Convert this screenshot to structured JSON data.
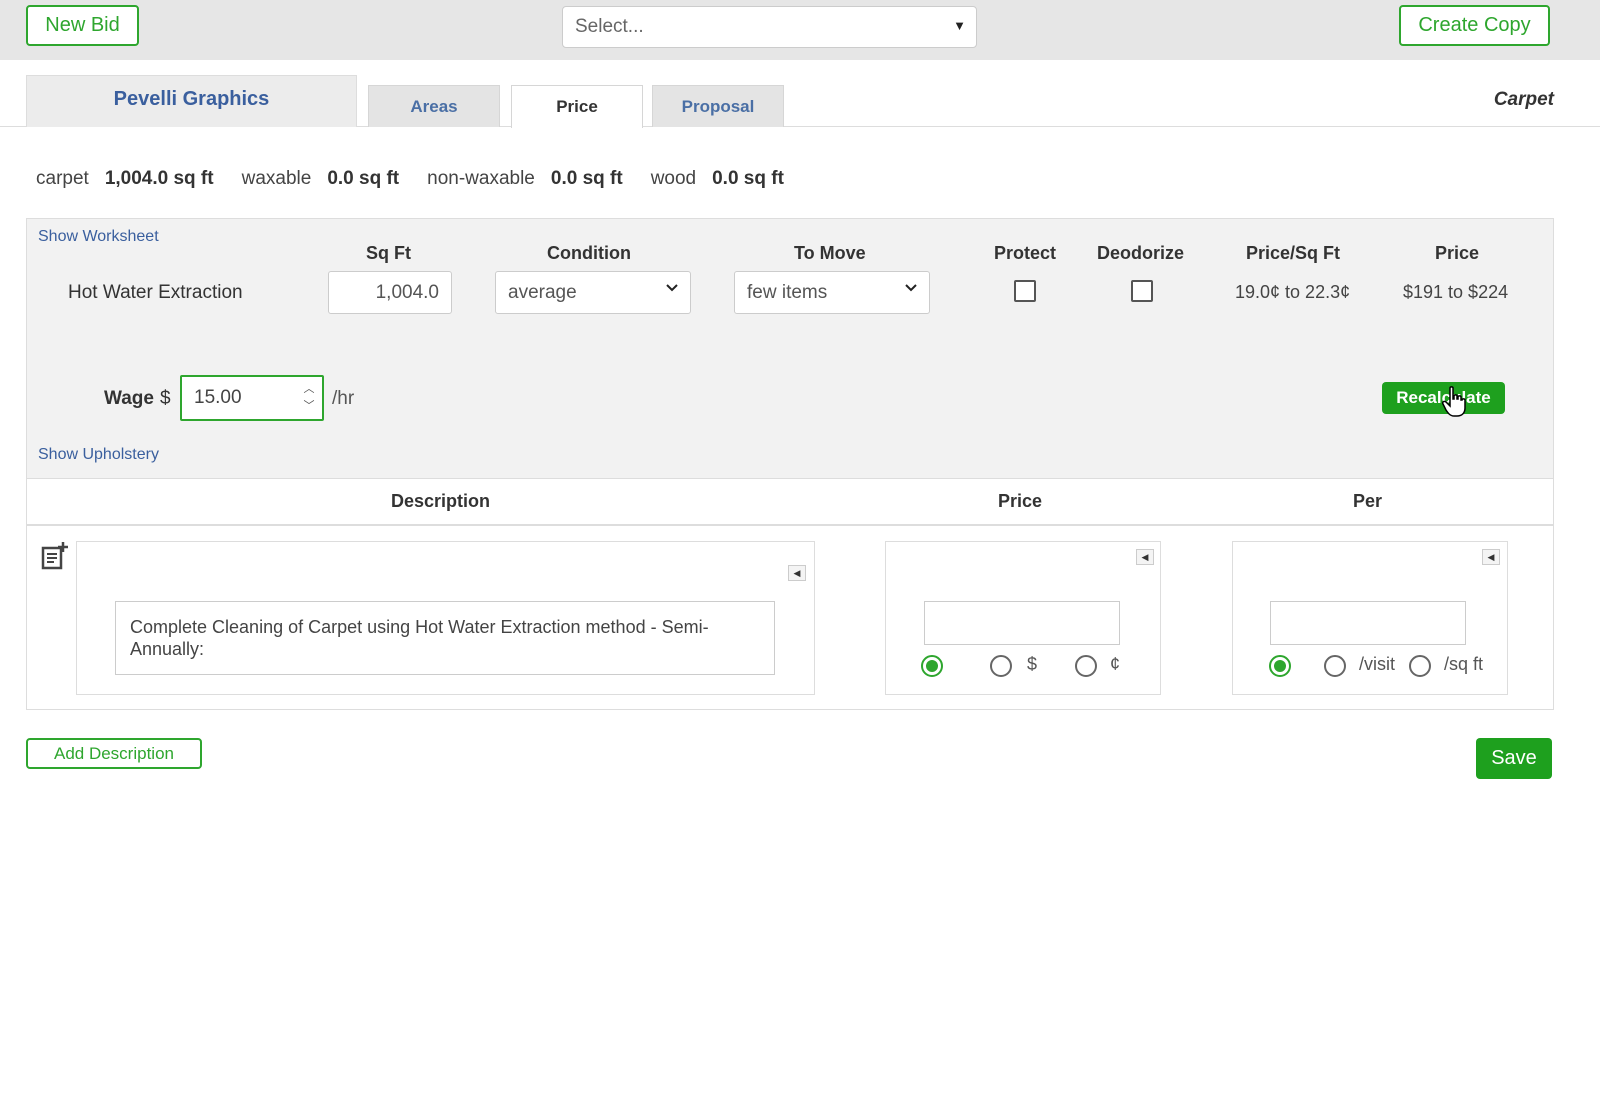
{
  "toolbar": {
    "new_bid_label": "New Bid",
    "select_placeholder": "Select...",
    "create_copy_label": "Create Copy"
  },
  "tabs": {
    "company": "Pevelli Graphics",
    "items": [
      "Areas",
      "Price",
      "Proposal"
    ],
    "active": "Price",
    "section_label": "Carpet"
  },
  "summary": [
    {
      "label": "carpet",
      "value": "1,004.0 sq ft"
    },
    {
      "label": "waxable",
      "value": "0.0 sq ft"
    },
    {
      "label": "non-waxable",
      "value": "0.0 sq ft"
    },
    {
      "label": "wood",
      "value": "0.0 sq ft"
    }
  ],
  "worksheet": {
    "show_worksheet_link": "Show Worksheet",
    "show_upholstery_link": "Show Upholstery",
    "columns": [
      "Sq Ft",
      "Condition",
      "To Move",
      "Protect",
      "Deodorize",
      "Price/Sq Ft",
      "Price"
    ],
    "row": {
      "label": "Hot Water Extraction",
      "sq_ft": "1,004.0",
      "condition": "average",
      "to_move": "few items",
      "protect": false,
      "deodorize": false,
      "price_per_sqft": "19.0¢ to 22.3¢",
      "price": "$191 to $224"
    },
    "wage_label": "Wage",
    "wage_currency": "$",
    "wage_value": "15.00",
    "wage_unit": "/hr",
    "recalculate_label": "Recalculate"
  },
  "descriptions": {
    "headers": {
      "description": "Description",
      "price": "Price",
      "per": "Per"
    },
    "rows": [
      {
        "text": "Complete Cleaning of Carpet using Hot Water Extraction method - Semi-Annually:",
        "price_value": "",
        "price_units": [
          "",
          "$",
          "¢"
        ],
        "price_selected": 0,
        "per_value": "",
        "per_units": [
          "",
          "/visit",
          "/sq ft"
        ],
        "per_selected": 0
      }
    ],
    "add_description_label": "Add Description",
    "save_label": "Save"
  },
  "colors": {
    "accent_green": "#1ea01e",
    "link_blue": "#3a5f9e",
    "panel_bg": "#f2f2f2"
  }
}
